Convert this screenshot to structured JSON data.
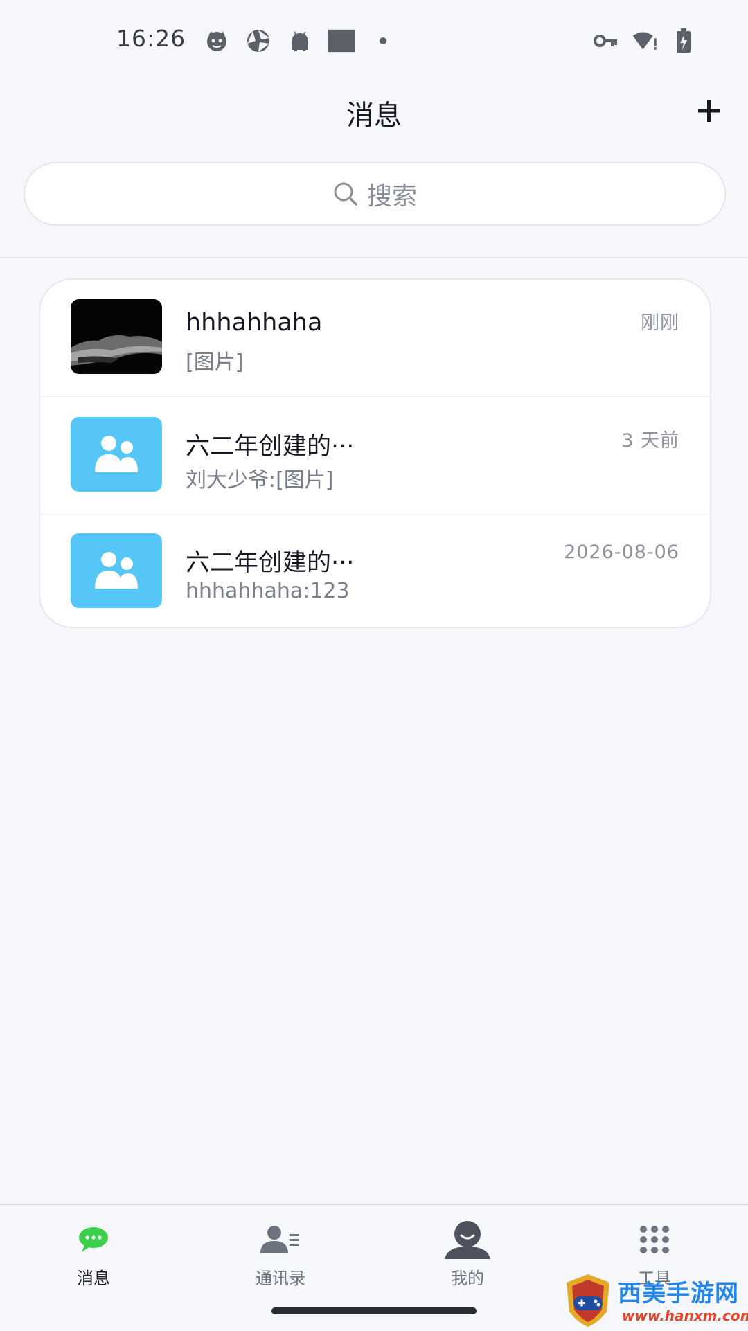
{
  "status_bar": {
    "time": "16:26",
    "left_icons": [
      "cat-face-icon",
      "aperture-icon",
      "android-icon",
      "square-icon",
      "dot-icon"
    ],
    "right_icons": [
      "vpn-key-icon",
      "wifi-alert-icon",
      "battery-charging-icon"
    ]
  },
  "header": {
    "title": "消息",
    "add_icon": "plus-icon"
  },
  "search": {
    "placeholder": "搜索",
    "icon": "search-icon"
  },
  "conversations": [
    {
      "name": "hhhahhaha",
      "preview": "[图片]",
      "time": "刚刚",
      "avatar": "photo"
    },
    {
      "name": "六二年创建的···",
      "preview": "刘大少爷:[图片]",
      "time": "3  天前",
      "avatar": "group"
    },
    {
      "name": "六二年创建的···",
      "preview": "hhhahhaha:123",
      "time": "2026-08-06",
      "avatar": "group"
    }
  ],
  "bottom_nav": [
    {
      "label": "消息",
      "icon": "chat-bubble-icon",
      "active": true
    },
    {
      "label": "通讯录",
      "icon": "contacts-icon",
      "active": false
    },
    {
      "label": "我的",
      "icon": "profile-icon",
      "active": false
    },
    {
      "label": "工具",
      "icon": "grid-icon",
      "active": false
    }
  ],
  "watermark": {
    "text": "西美手游网",
    "url": "www.hanxm.com"
  },
  "colors": {
    "background": "#f6f7fb",
    "group_avatar": "#55c6f5",
    "active_nav": "#3ccf4e"
  }
}
